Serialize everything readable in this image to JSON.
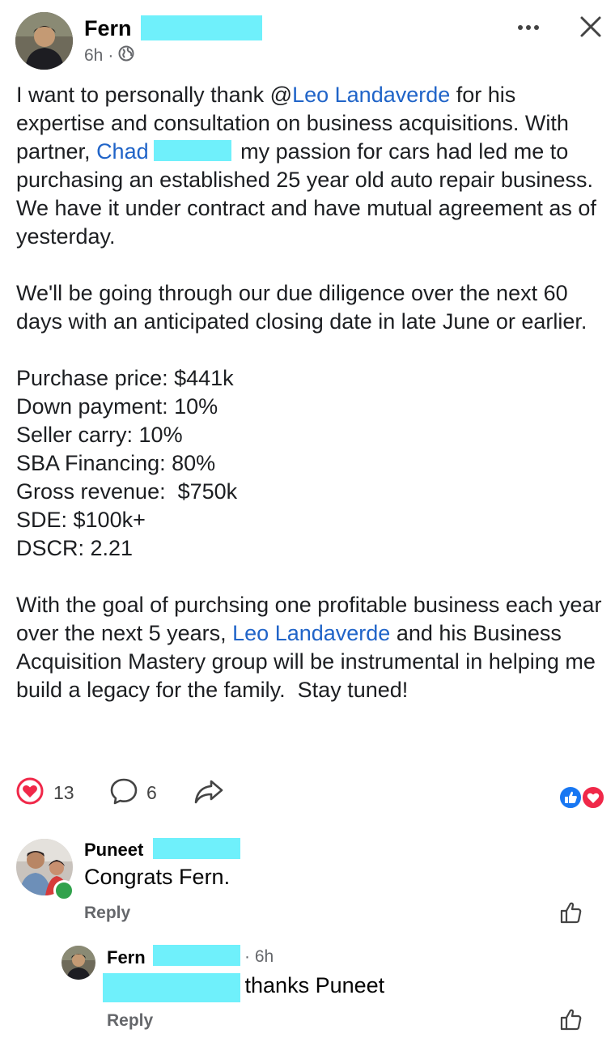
{
  "post": {
    "author_first": "Fern",
    "time": "6h",
    "privacy_icon": "globe-icon",
    "menu_icon": "more-dots-icon",
    "close_icon": "close-icon",
    "body": {
      "p1_pre": "I want to personally thank @",
      "mention_leo": "Leo Landaverde",
      "p1_post": " for his expertise and consultation on business acquisitions. With partner, ",
      "mention_chad": "Chad",
      "p1_after_chad": " my passion for cars had led me to purchasing an established 25 year old auto repair business. We have it under contract and have mutual agreement as of yesterday.",
      "p2": "We'll be going through our due diligence over the next 60 days with an anticipated closing date in late June or earlier.",
      "stats": [
        "Purchase price: $441k",
        "Down payment: 10%",
        "Seller carry: 10%",
        "SBA Financing: 80%",
        "Gross revenue:  $750k",
        "SDE: $100k+",
        "DSCR: 2.21"
      ],
      "p4_pre": "With the goal of purchsing one profitable business each year over the next 5 years, ",
      "mention_leo2": "Leo Landaverde",
      "p4_post": " and his Business Acquisition Mastery group will be instrumental in helping me build a legacy for the family.  Stay tuned!"
    },
    "reactions_count": "13",
    "comments_count": "6",
    "colors": {
      "love": "#f02849",
      "like": "#1877f2",
      "link": "#2064c8",
      "redaction": "#6ff0fb",
      "online": "#31a24c"
    }
  },
  "comments": [
    {
      "author_first": "Puneet",
      "text": "Congrats Fern.",
      "reply_label": "Reply",
      "online": true
    },
    {
      "author_first": "Fern",
      "time": "· 6h",
      "text": "a thanks Puneet",
      "reply_label": "Reply"
    }
  ]
}
